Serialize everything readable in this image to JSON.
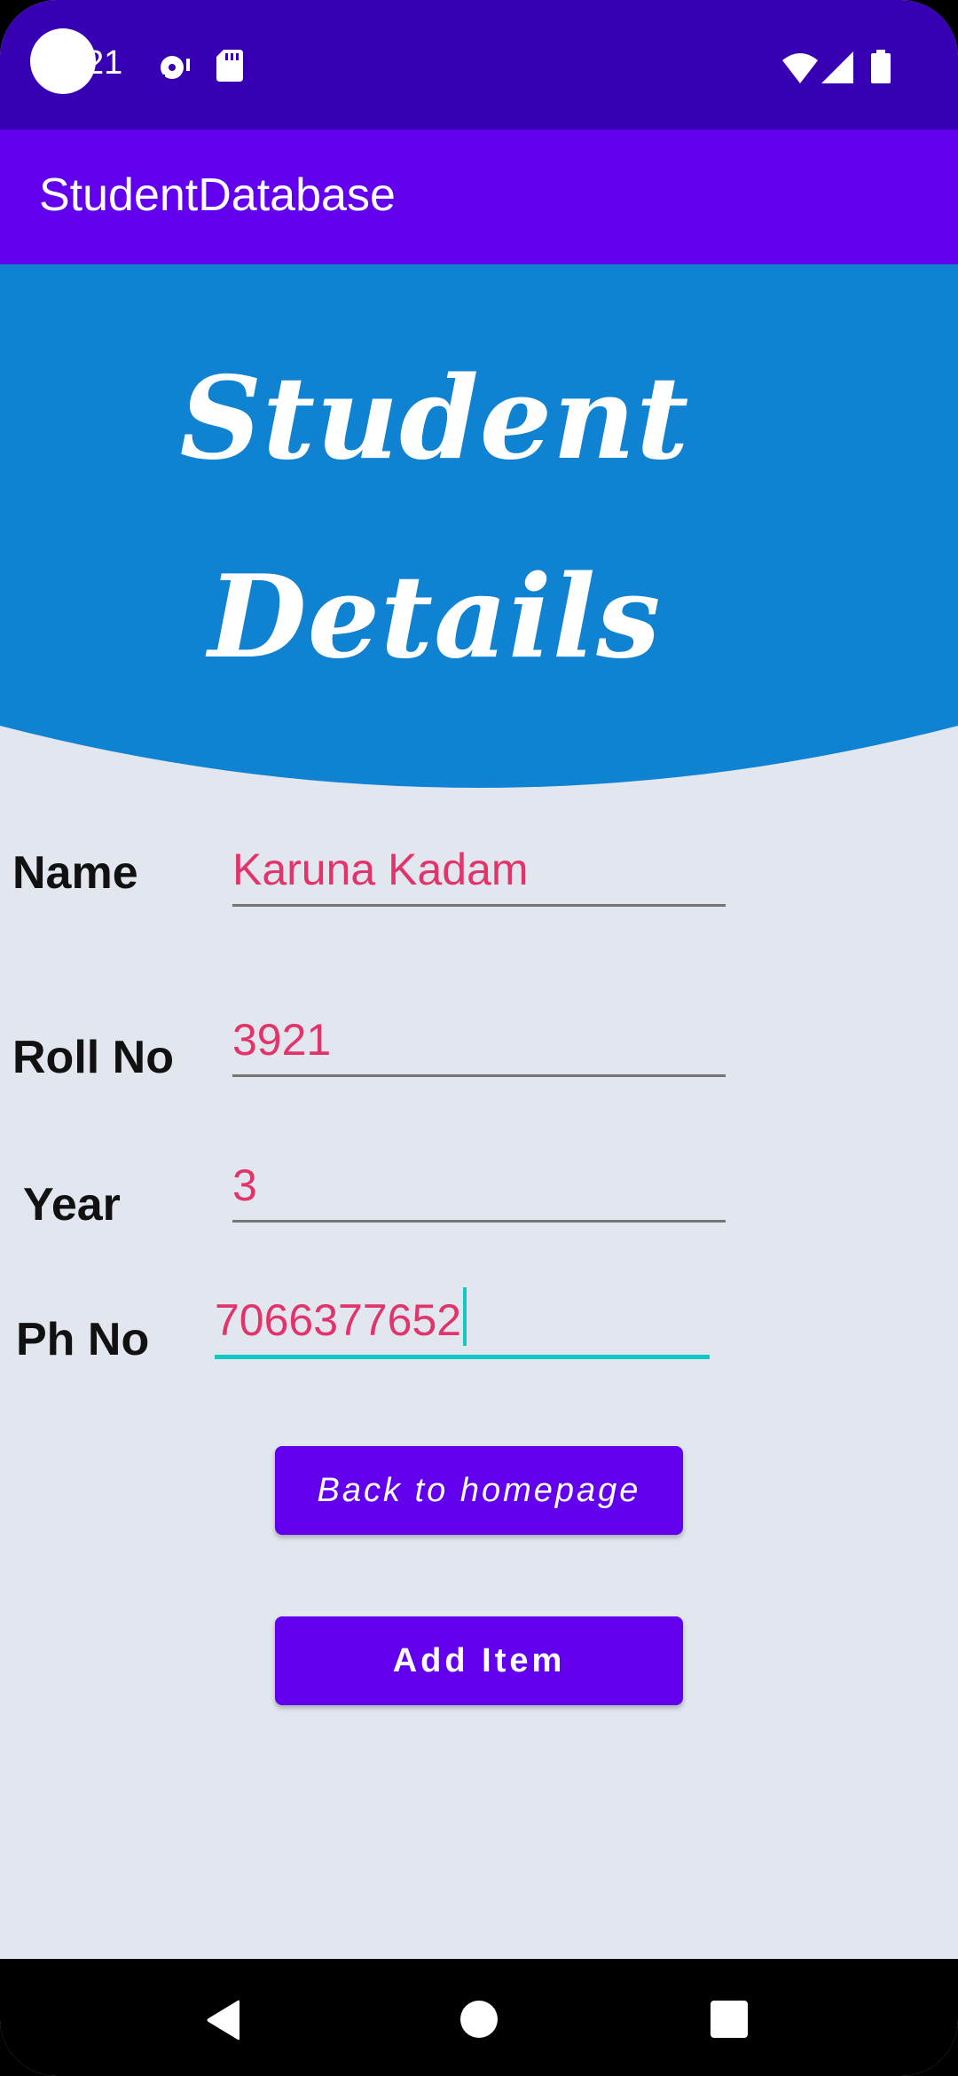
{
  "status_bar": {
    "time": "21",
    "icons": [
      "notification-icon",
      "sd-card-icon",
      "wifi-icon",
      "signal-icon",
      "battery-icon"
    ]
  },
  "app_bar": {
    "title": "StudentDatabase"
  },
  "header": {
    "line1": "Student",
    "line2": "Details",
    "background_color": "#0f82d1"
  },
  "form": {
    "name": {
      "label": "Name",
      "value": "Karuna Kadam"
    },
    "roll_no": {
      "label": "Roll No",
      "value": "3921"
    },
    "year": {
      "label": "Year",
      "value": "3"
    },
    "phone": {
      "label": "Ph No",
      "value": "7066377652"
    }
  },
  "buttons": {
    "back": "Back to homepage",
    "add": "Add Item"
  },
  "nav_bar": {
    "icons": [
      "back-icon",
      "home-icon",
      "recents-icon"
    ]
  },
  "colors": {
    "status_bar": "#3700b3",
    "app_bar": "#6200ee",
    "accent": "#11c9c0",
    "input_text": "#e0346a",
    "page_background": "#e2e7ef"
  }
}
